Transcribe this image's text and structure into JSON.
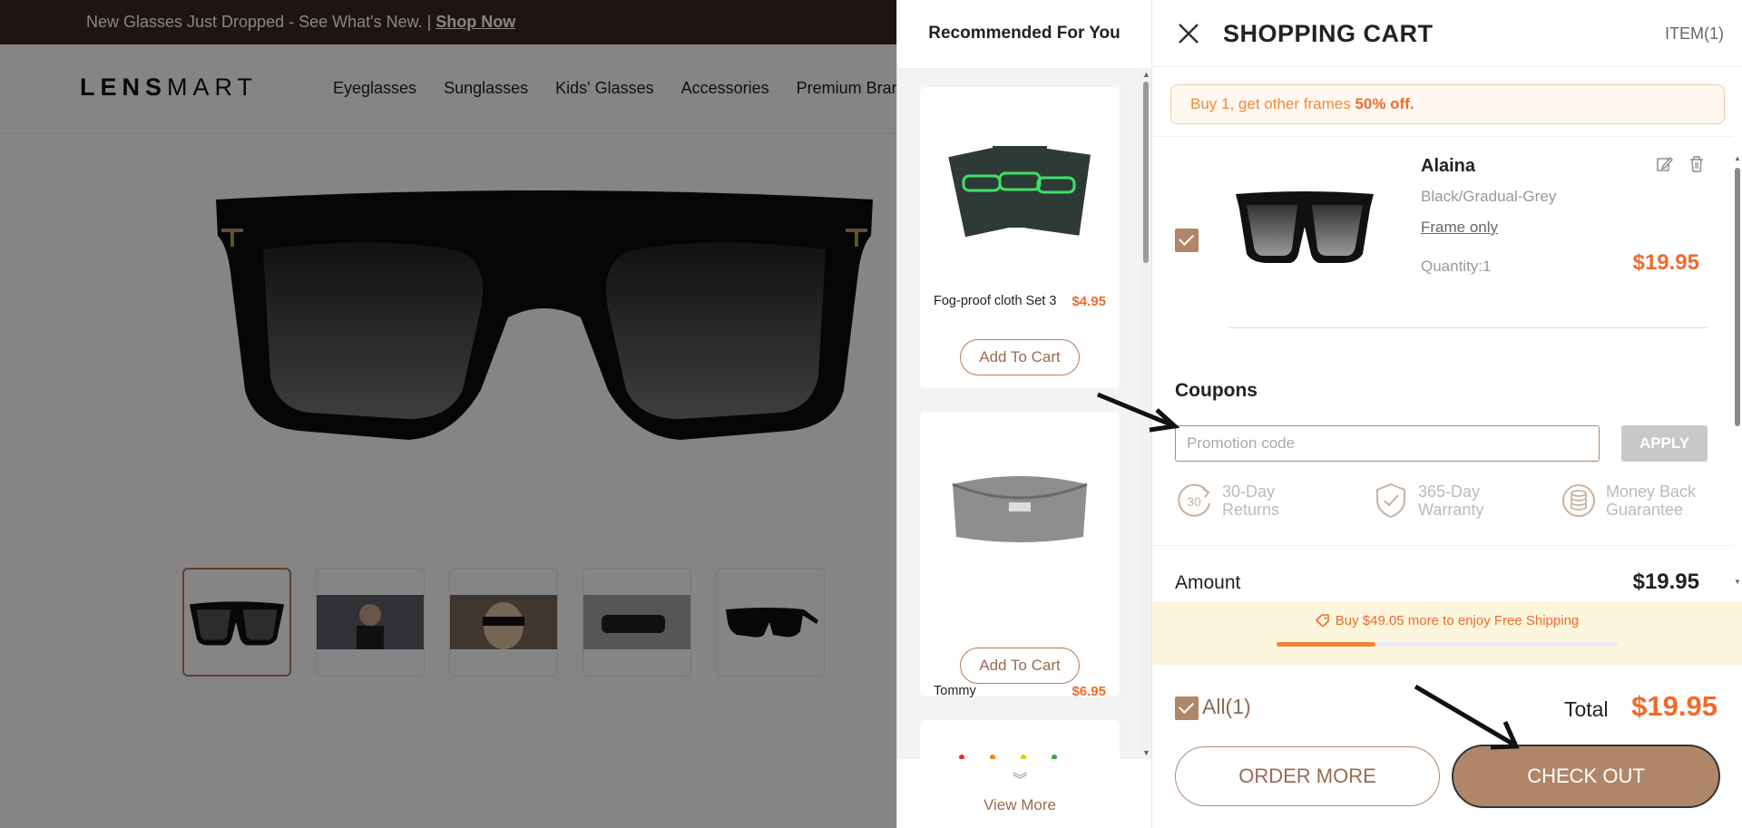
{
  "banner": {
    "text": "New Glasses Just Dropped - See What's New. | ",
    "link": "Shop Now"
  },
  "site": {
    "logo_bold": "LENS",
    "logo_rest": "MART",
    "nav": [
      "Eyeglasses",
      "Sunglasses",
      "Kids' Glasses",
      "Accessories",
      "Premium Brar"
    ]
  },
  "recommended": {
    "title": "Recommended For You",
    "items": [
      {
        "name": "Fog-proof cloth Set 3",
        "price": "$4.95",
        "button": "Add To Cart"
      },
      {
        "name": "Tommy",
        "price": "$6.95",
        "button": "Add To Cart"
      }
    ],
    "view_more": "View More"
  },
  "cart": {
    "title": "SHOPPING CART",
    "item_count": "ITEM(1)",
    "offer_text": "Buy 1, get other frames ",
    "offer_bold": "50% off.",
    "item": {
      "name": "Alaina",
      "variant": "Black/Gradual-Grey",
      "frame": "Frame only",
      "quantity": "Quantity:1",
      "price": "$19.95"
    },
    "coupons_title": "Coupons",
    "promo_placeholder": "Promotion code",
    "apply_label": "APPLY",
    "perks": [
      {
        "line1": "30-Day",
        "line2": "Returns",
        "icon": "returns-30-icon"
      },
      {
        "line1": "365-Day",
        "line2": "Warranty",
        "icon": "shield-check-icon"
      },
      {
        "line1": "Money Back",
        "line2": "Guarantee",
        "icon": "coins-icon"
      }
    ],
    "amount_label": "Amount",
    "amount_value": "$19.95",
    "shipping_text": "Buy $49.05 more to enjoy Free Shipping",
    "shipping_progress": 0.29,
    "all_label": "All(1)",
    "total_label": "Total",
    "total_value": "$19.95",
    "order_more": "ORDER MORE",
    "checkout": "CHECK OUT"
  },
  "colors": {
    "accent": "#b08669",
    "price": "#f06a2a",
    "banner_bg": "#3a2a24"
  }
}
